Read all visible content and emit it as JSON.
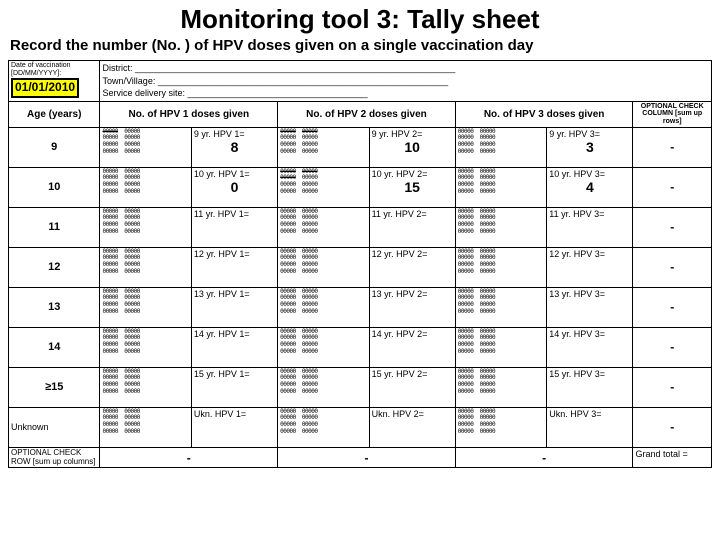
{
  "title": "Monitoring tool 3: Tally sheet",
  "subtitle": "Record the number (No. ) of HPV doses given on a single vaccination day",
  "date_label": "Date of vaccination [DD/MM/YYYY]:",
  "date_value": "01/01/2010",
  "district_label": "District: ________________________________________________________________",
  "town_label": "Town/Village: __________________________________________________________",
  "service_label": "Service delivery site: ____________________________________",
  "age_header": "Age (years)",
  "dose1_header": "No. of HPV 1 doses given",
  "dose2_header": "No. of HPV 2 doses given",
  "dose3_header": "No. of HPV 3 doses given",
  "optional_col_header": "OPTIONAL CHECK COLUMN [sum up rows]",
  "tally_block": "00000  00000",
  "rows": [
    {
      "age": "9",
      "r1": "9 yr. HPV 1=",
      "v1": "8",
      "r2": "9 yr. HPV 2=",
      "v2": "10",
      "r3": "9 yr. HPV 3=",
      "v3": "3",
      "sum": "-",
      "struck1": 1,
      "struck2": 2,
      "struck3": 0
    },
    {
      "age": "10",
      "r1": "10 yr. HPV 1=",
      "v1": "0",
      "r2": "10 yr. HPV 2=",
      "v2": "15",
      "r3": "10 yr. HPV 3=",
      "v3": "4",
      "sum": "-",
      "struck1": 0,
      "struck2": 3,
      "struck3": 0
    },
    {
      "age": "11",
      "r1": "11 yr. HPV 1=",
      "v1": "",
      "r2": "11 yr. HPV 2=",
      "v2": "",
      "r3": "11 yr. HPV 3=",
      "v3": "",
      "sum": "-"
    },
    {
      "age": "12",
      "r1": "12 yr. HPV 1=",
      "v1": "",
      "r2": "12 yr. HPV 2=",
      "v2": "",
      "r3": "12 yr. HPV 3=",
      "v3": "",
      "sum": "-"
    },
    {
      "age": "13",
      "r1": "13 yr. HPV 1=",
      "v1": "",
      "r2": "13 yr. HPV 2=",
      "v2": "",
      "r3": "13 yr. HPV 3=",
      "v3": "",
      "sum": "-"
    },
    {
      "age": "14",
      "r1": "14 yr. HPV 1=",
      "v1": "",
      "r2": "14 yr. HPV 2=",
      "v2": "",
      "r3": "14 yr. HPV 3=",
      "v3": "",
      "sum": "-"
    },
    {
      "age": "≥15",
      "r1": "15 yr. HPV 1=",
      "v1": "",
      "r2": "15 yr. HPV 2=",
      "v2": "",
      "r3": "15 yr. HPV 3=",
      "v3": "",
      "sum": "-"
    },
    {
      "age": "Unknown",
      "r1": "Ukn. HPV 1=",
      "v1": "",
      "r2": "Ukn. HPV 2=",
      "v2": "",
      "r3": "Ukn. HPV 3=",
      "v3": "",
      "sum": "-"
    }
  ],
  "optional_row_header": "OPTIONAL CHECK ROW [sum up columns]",
  "dash": "-",
  "grand_total_label": "Grand total ="
}
